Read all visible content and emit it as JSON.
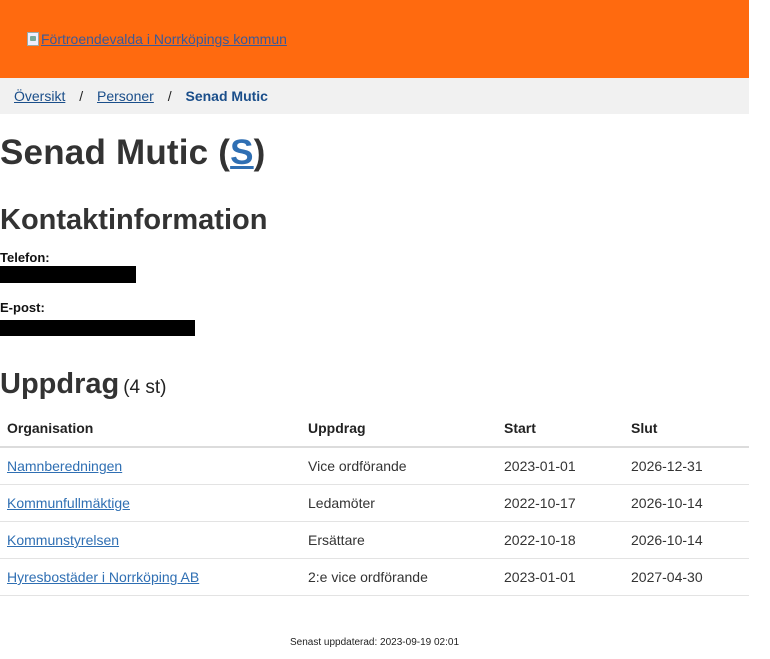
{
  "header": {
    "logo_alt": "Förtroendevalda i Norrköpings kommun",
    "color": "#ff6a0f"
  },
  "breadcrumb": {
    "items": [
      "Översikt",
      "Personer"
    ],
    "separator": "/",
    "current": "Senad Mutic"
  },
  "person": {
    "name": "Senad Mutic",
    "party": "S"
  },
  "contact": {
    "heading": "Kontaktinformation",
    "phone_label": "Telefon:",
    "email_label": "E-post:"
  },
  "assignments": {
    "heading": "Uppdrag",
    "count": "(4 st)",
    "columns": [
      "Organisation",
      "Uppdrag",
      "Start",
      "Slut"
    ],
    "rows": [
      [
        "Namnberedningen",
        "Vice ordförande",
        "2023-01-01",
        "2026-12-31"
      ],
      [
        "Kommunfullmäktige",
        "Ledamöter",
        "2022-10-17",
        "2026-10-14"
      ],
      [
        "Kommunstyrelsen",
        "Ersättare",
        "2022-10-18",
        "2026-10-14"
      ],
      [
        "Hyresbostäder i Norrköping AB",
        "2:e vice ordförande",
        "2023-01-01",
        "2027-04-30"
      ]
    ]
  },
  "footer": {
    "updated": "Senast uppdaterad: 2023-09-19 02:01"
  }
}
